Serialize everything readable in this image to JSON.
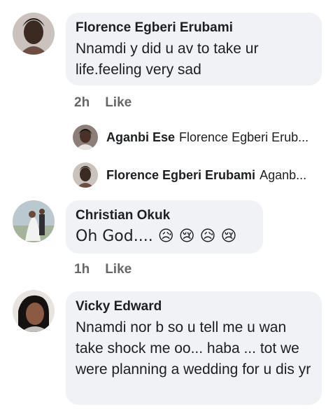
{
  "comments": [
    {
      "author": "Florence Egberi Erubami",
      "text": "Nnamdi y did u av to take ur life.feeling very sad",
      "time": "2h",
      "like": "Like"
    },
    {
      "author": "Christian Okuk",
      "text": "Oh God.... 😥 😢 😥 😢",
      "time": "1h",
      "like": "Like"
    },
    {
      "author": "Vicky Edward",
      "text": "Nnamdi nor b so u tell me u wan take shock me oo... haba ... tot we were planning a wedding for u dis yr"
    }
  ],
  "replies": [
    {
      "author": "Aganbi Ese",
      "preview": "Florence Egberi Erub..."
    },
    {
      "author": "Florence Egberi Erubami",
      "preview": "Aganb..."
    }
  ]
}
